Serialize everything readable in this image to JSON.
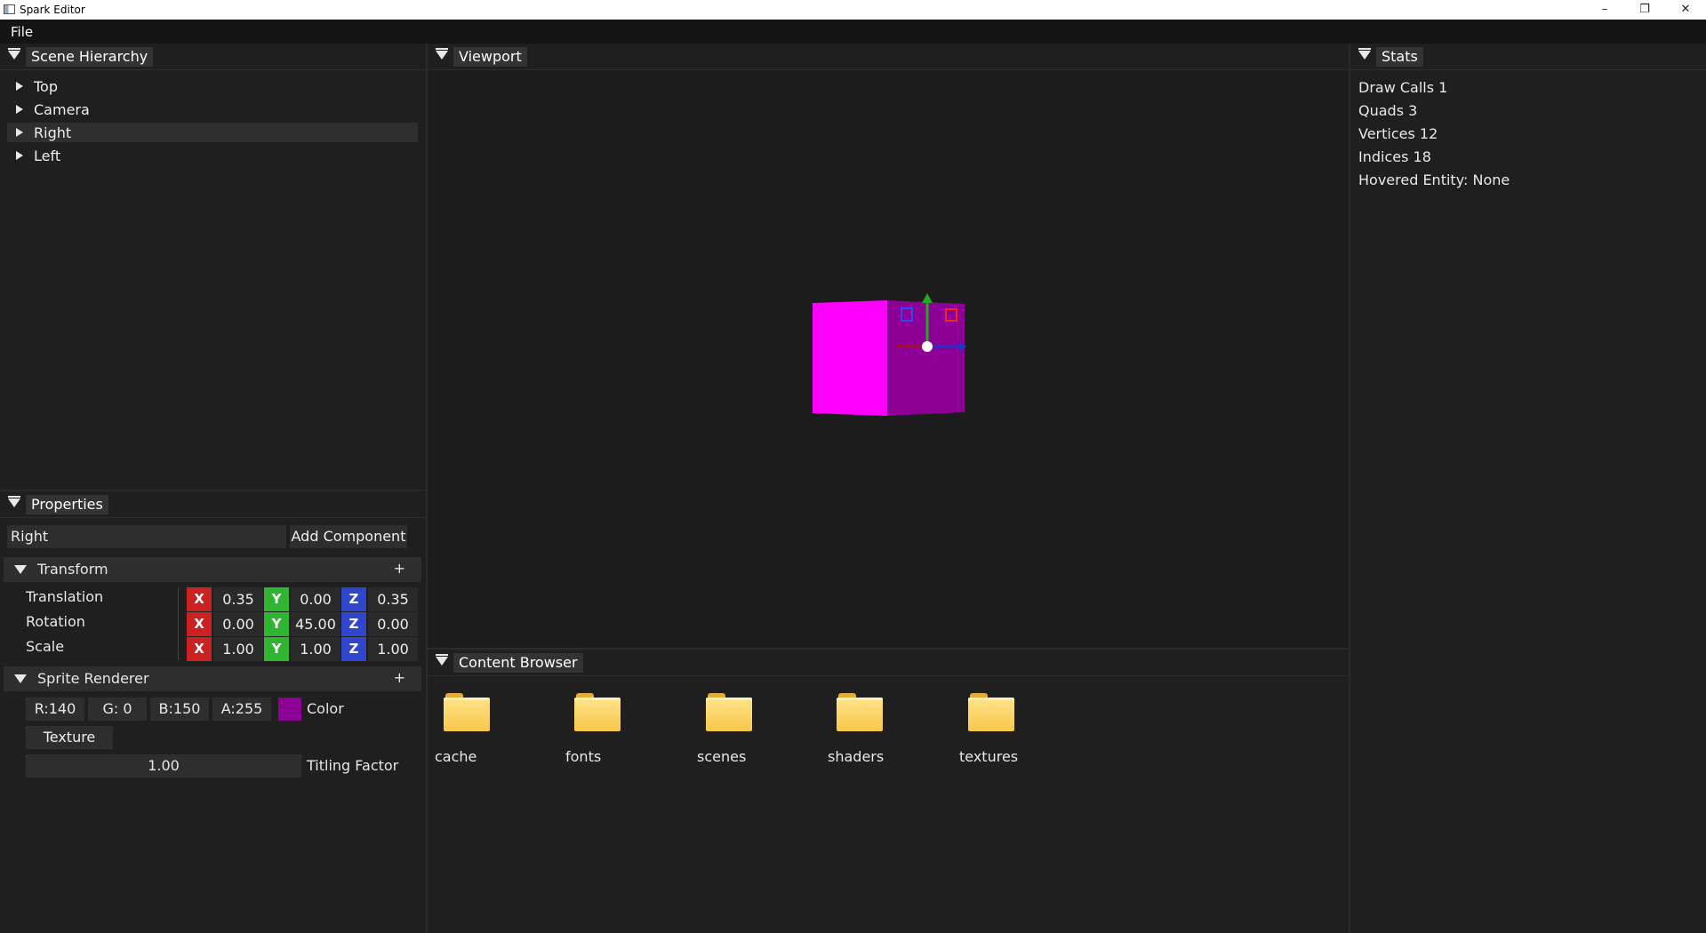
{
  "window": {
    "title": "Spark Editor",
    "controls": [
      "–",
      "❐",
      "✕"
    ]
  },
  "menu": {
    "file": "File"
  },
  "hierarchy": {
    "tab": "Scene Hierarchy",
    "items": [
      {
        "label": "Top"
      },
      {
        "label": "Camera"
      },
      {
        "label": "Right"
      },
      {
        "label": "Left"
      }
    ]
  },
  "viewport": {
    "tab": "Viewport"
  },
  "stats": {
    "tab": "Stats",
    "lines": [
      "Draw Calls 1",
      "Quads 3",
      "Vertices 12",
      "Indices 18",
      "Hovered Entity: None"
    ]
  },
  "properties": {
    "tab": "Properties",
    "name_value": "Right",
    "add_component": "Add Component",
    "transform": {
      "title": "Transform",
      "plus": "+",
      "rows": [
        {
          "label": "Translation",
          "x": "0.35",
          "y": "0.00",
          "z": "0.35"
        },
        {
          "label": "Rotation",
          "x": "0.00",
          "y": "45.00",
          "z": "0.00"
        },
        {
          "label": "Scale",
          "x": "1.00",
          "y": "1.00",
          "z": "1.00"
        }
      ],
      "axis_letters": {
        "x": "X",
        "y": "Y",
        "z": "Z"
      }
    },
    "sprite": {
      "title": "Sprite Renderer",
      "plus": "+",
      "r": "R:140",
      "g": "G:  0",
      "b": "B:150",
      "a": "A:255",
      "color_label": "Color",
      "swatch": "#8c0096",
      "texture": "Texture",
      "tiling_value": "1.00",
      "tiling_label": "Titling Factor"
    }
  },
  "content_browser": {
    "tab": "Content Browser",
    "folders": [
      "cache",
      "fonts",
      "scenes",
      "shaders",
      "textures"
    ]
  },
  "colors": {
    "cube_front": "#ff00ff",
    "cube_side": "#8c0096",
    "background": "#141414",
    "panel": "#1f1f1f"
  }
}
